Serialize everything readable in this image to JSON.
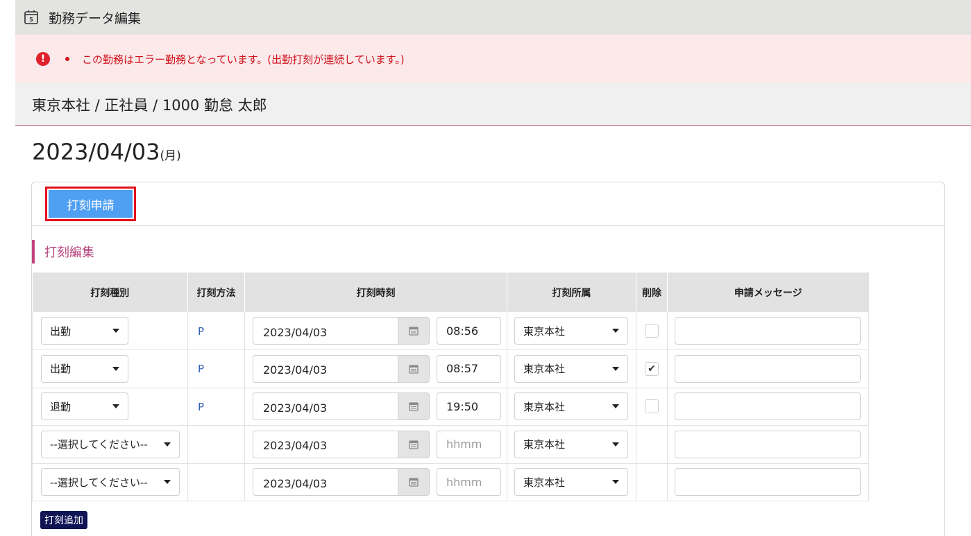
{
  "header": {
    "title": "勤務データ編集",
    "icon": "calendar-icon"
  },
  "error": {
    "message": "この勤務はエラー勤務となっています。(出勤打刻が連続しています。)",
    "color": "#d0111b"
  },
  "org": {
    "path": "東京本社 / 正社員 / 1000 勤怠 太郎"
  },
  "date": {
    "value": "2023/04/03",
    "weekday": "(月)"
  },
  "apply_button": {
    "label": "打刻申請"
  },
  "section": {
    "title": "打刻編集"
  },
  "table": {
    "headers": {
      "type": "打刻種別",
      "method": "打刻方法",
      "time": "打刻時刻",
      "affiliation": "打刻所属",
      "delete": "削除",
      "message": "申請メッセージ"
    },
    "rows": [
      {
        "type": "出勤",
        "method": "P",
        "date": "2023/04/03",
        "time": "08:56",
        "time_placeholder": "",
        "affiliation": "東京本社",
        "delete": "unchecked",
        "message": ""
      },
      {
        "type": "出勤",
        "method": "P",
        "date": "2023/04/03",
        "time": "08:57",
        "time_placeholder": "",
        "affiliation": "東京本社",
        "delete": "checked",
        "message": ""
      },
      {
        "type": "退勤",
        "method": "P",
        "date": "2023/04/03",
        "time": "19:50",
        "time_placeholder": "",
        "affiliation": "東京本社",
        "delete": "unchecked",
        "message": ""
      },
      {
        "type": "--選択してください--",
        "method": "",
        "date": "2023/04/03",
        "time": "",
        "time_placeholder": "hhmm",
        "affiliation": "東京本社",
        "delete": "none",
        "message": ""
      },
      {
        "type": "--選択してください--",
        "method": "",
        "date": "2023/04/03",
        "time": "",
        "time_placeholder": "hhmm",
        "affiliation": "東京本社",
        "delete": "none",
        "message": ""
      }
    ]
  },
  "add_button": {
    "label": "打刻追加"
  },
  "checkmark": "✔"
}
